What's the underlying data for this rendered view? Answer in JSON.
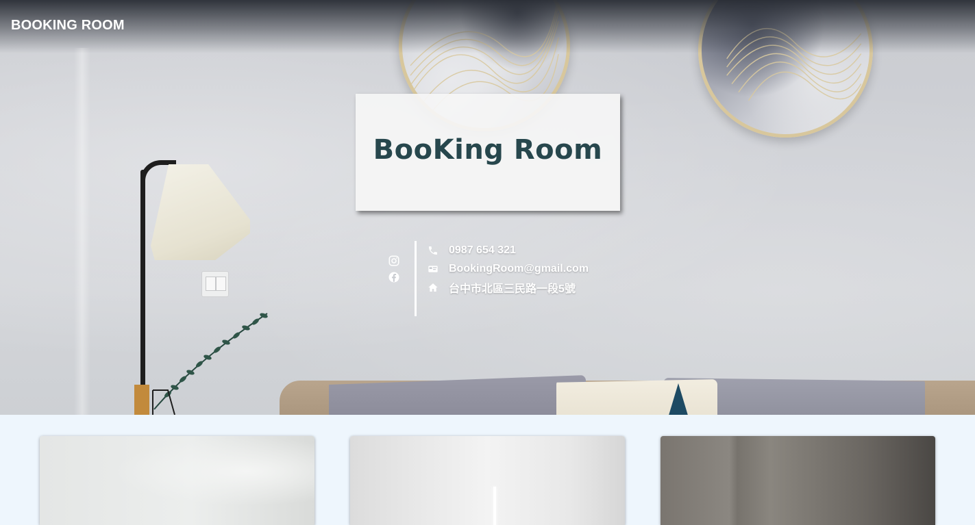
{
  "header": {
    "brand": "BOOKING ROOM"
  },
  "hero": {
    "title": "BooKing Room",
    "social": [
      {
        "icon": "instagram-icon"
      },
      {
        "icon": "facebook-icon"
      }
    ],
    "contact": {
      "phone": {
        "icon": "phone-icon",
        "text": "0987 654 321"
      },
      "email": {
        "icon": "id-card-icon",
        "text": "BookingRoom@gmail.com"
      },
      "address": {
        "icon": "home-icon",
        "text": "台中市北區三民路一段5號"
      }
    }
  },
  "rooms": [
    {
      "icon": "room-photo-1"
    },
    {
      "icon": "room-photo-2"
    },
    {
      "icon": "room-photo-3"
    }
  ],
  "colors": {
    "title_text": "#27474d",
    "page_background": "#eef6fd",
    "frame_gold": "#d8c79c"
  }
}
